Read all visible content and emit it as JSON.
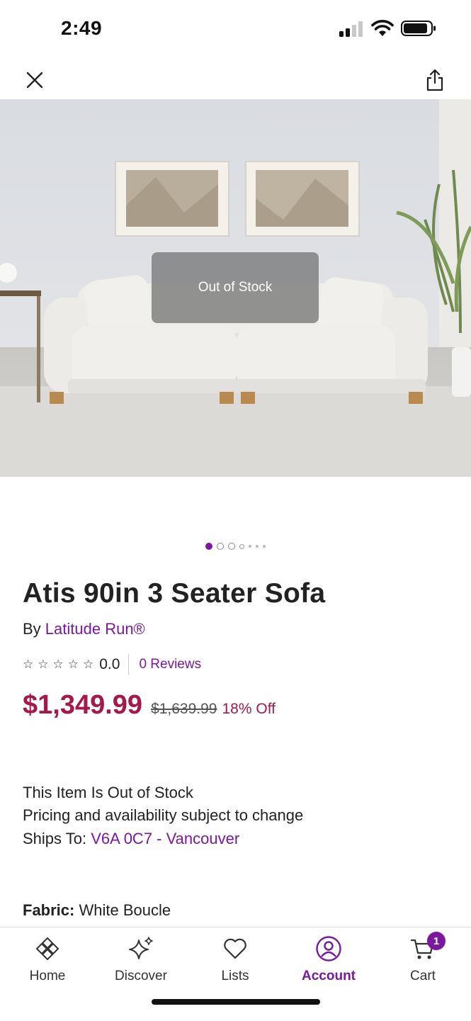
{
  "status": {
    "time": "2:49"
  },
  "hero": {
    "overlay_text": "Out of Stock"
  },
  "carousel": {
    "dots": [
      "active",
      "ring",
      "ring",
      "ring-sm",
      "tiny",
      "tiny",
      "tiny"
    ]
  },
  "product": {
    "title": "Atis 90in 3 Seater Sofa",
    "by_label": "By ",
    "brand": "Latitude Run®",
    "rating_value": "0.0",
    "reviews": "0 Reviews",
    "star_count": 5,
    "price": "$1,349.99",
    "was_price": "$1,639.99",
    "discount": "18% Off",
    "stock_line1": "This Item Is Out of Stock",
    "stock_line2": "Pricing and availability subject to change",
    "ships_label": "Ships To: ",
    "ships_location": "V6A 0C7 - Vancouver",
    "fabric_label": "Fabric:",
    "fabric_value": " White Boucle"
  },
  "tabs": [
    {
      "label": "Home",
      "icon": "home-icon"
    },
    {
      "label": "Discover",
      "icon": "sparkle-icon"
    },
    {
      "label": "Lists",
      "icon": "heart-icon"
    },
    {
      "label": "Account",
      "icon": "account-icon",
      "active": true
    },
    {
      "label": "Cart",
      "icon": "cart-icon",
      "badge": "1"
    }
  ],
  "colors": {
    "accent": "#7b189f",
    "price": "#a6174b"
  }
}
